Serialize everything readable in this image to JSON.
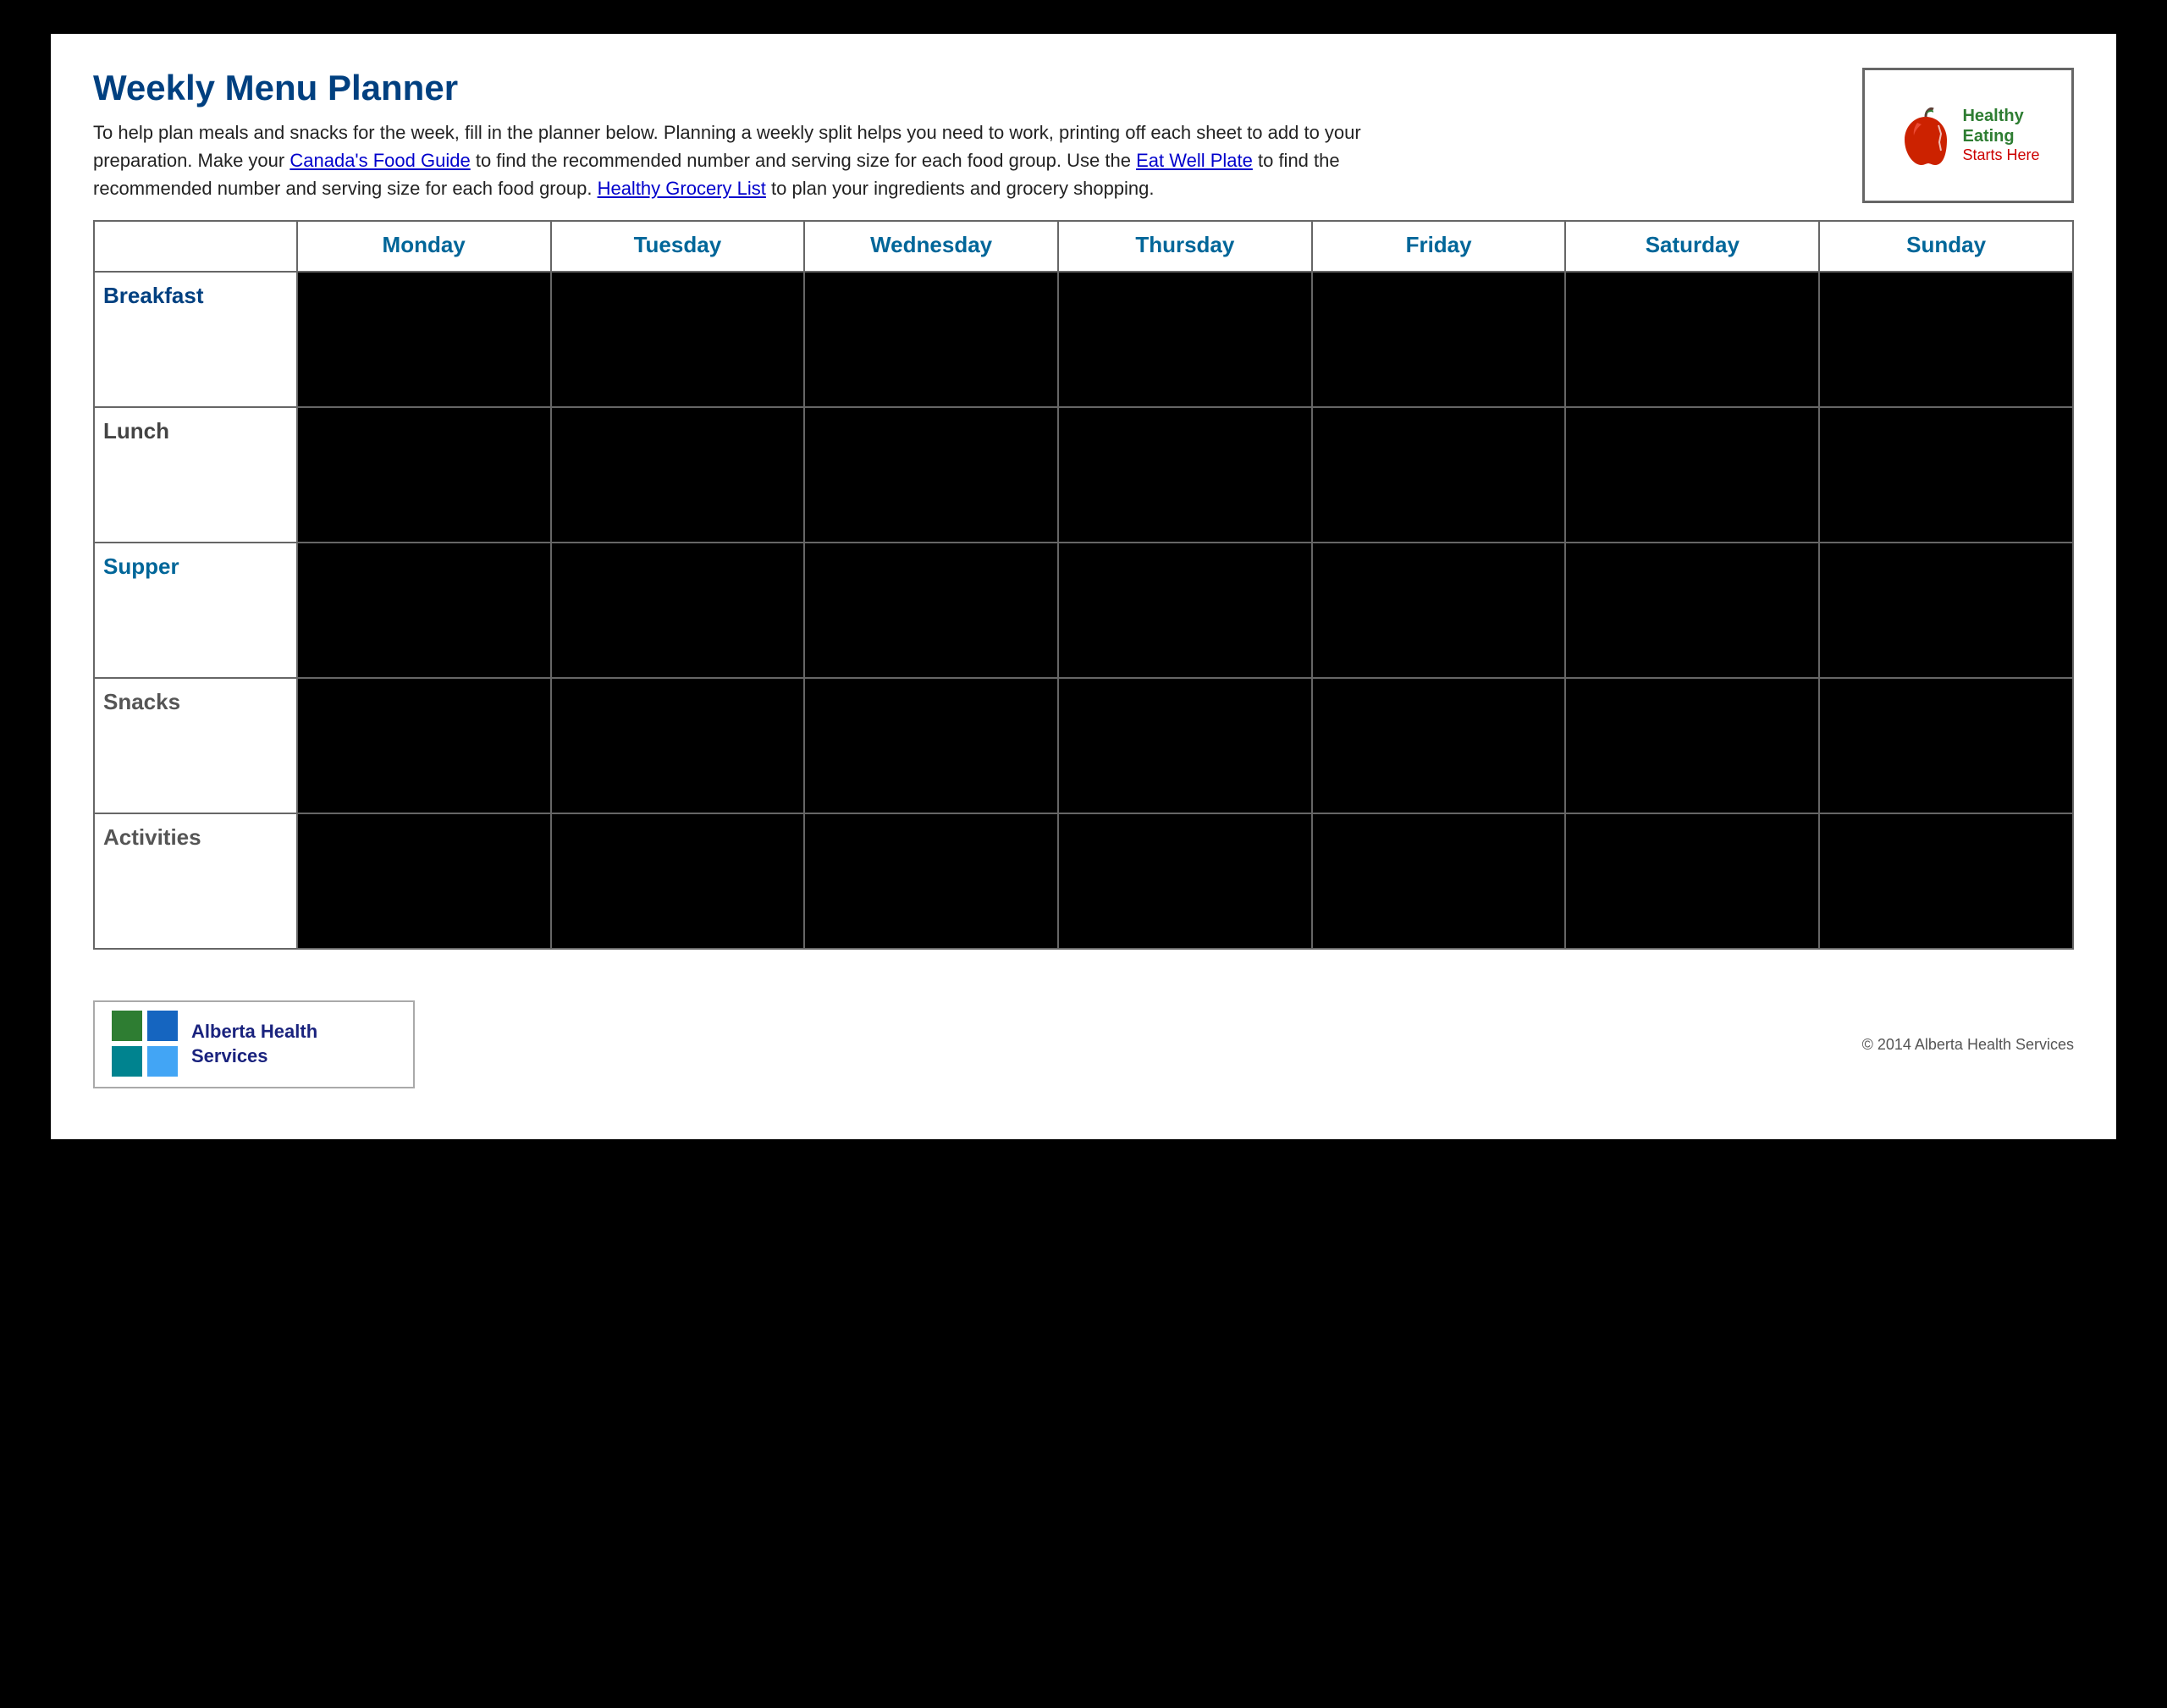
{
  "page": {
    "title": "Weekly Menu Planner",
    "description_part1": "To help plan meals and snacks for the week, fill in the planner below. Planning a weekly split helps you need to work, printing off each sheet to add to your preparation. Make your",
    "description_link1": "Canada's Food Guide",
    "description_link1_url": "#",
    "description_part2": "to find the recommended number and serving size for each food group. Use the",
    "description_link2": "Eat Well Plate",
    "description_link2_url": "#",
    "description_part3": "to find the recommended number and serving size for each food group.",
    "description_link3": "Healthy Grocery List",
    "description_link3_url": "#",
    "description_part4": "to plan your ingredients and grocery shopping."
  },
  "logo": {
    "text_line1": "Healthy Eating",
    "text_line2": "Starts Here"
  },
  "table": {
    "corner_label": "",
    "days": [
      "Monday",
      "Tuesday",
      "Wednesday",
      "Thursday",
      "Friday",
      "Saturday",
      "Sunday"
    ],
    "rows": [
      {
        "label": "Breakfast",
        "label_class": "breakfast-label"
      },
      {
        "label": "Lunch",
        "label_class": "lunch-label"
      },
      {
        "label": "Supper",
        "label_class": "supper-label"
      },
      {
        "label": "Snacks",
        "label_class": "snacks-label"
      },
      {
        "label": "Activities",
        "label_class": "activities-label"
      }
    ]
  },
  "footer": {
    "alberta_org_line1": "Alberta Health",
    "alberta_org_line2": "Services",
    "copyright": "© 2014 Alberta Health Services"
  }
}
